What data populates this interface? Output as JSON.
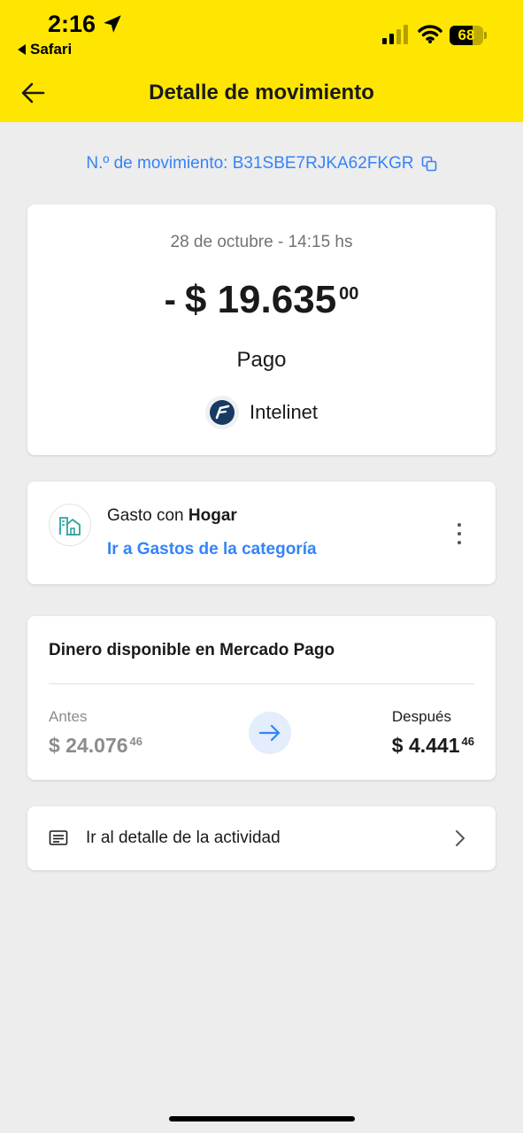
{
  "status_bar": {
    "time": "2:16",
    "back_app": "Safari",
    "battery_level": 68,
    "battery": "68"
  },
  "header": {
    "title": "Detalle de movimiento",
    "back_icon": "arrow-left-icon"
  },
  "movement": {
    "id_label": "N.º de movimiento: B31SBE7RJKA62FKGR",
    "copy_icon": "copy-icon"
  },
  "summary": {
    "date": "28 de octubre - 14:15 hs",
    "sign": "-",
    "amount_main": "$ 19.635",
    "amount_cents": "00",
    "type": "Pago",
    "merchant": "Intelinet"
  },
  "category": {
    "prefix": "Gasto con ",
    "name": "Hogar",
    "link": "Ir a Gastos de la categoría",
    "icon": "home-category-icon"
  },
  "balance": {
    "title": "Dinero disponible en Mercado Pago",
    "before_label": "Antes",
    "before_main": "$ 24.076",
    "before_cents": "46",
    "after_label": "Después",
    "after_main": "$ 4.441",
    "after_cents": "46"
  },
  "activity": {
    "label": "Ir al detalle de la actividad"
  },
  "colors": {
    "brand_yellow": "#ffe600",
    "link_blue": "#3483fa",
    "background": "#ededed"
  }
}
